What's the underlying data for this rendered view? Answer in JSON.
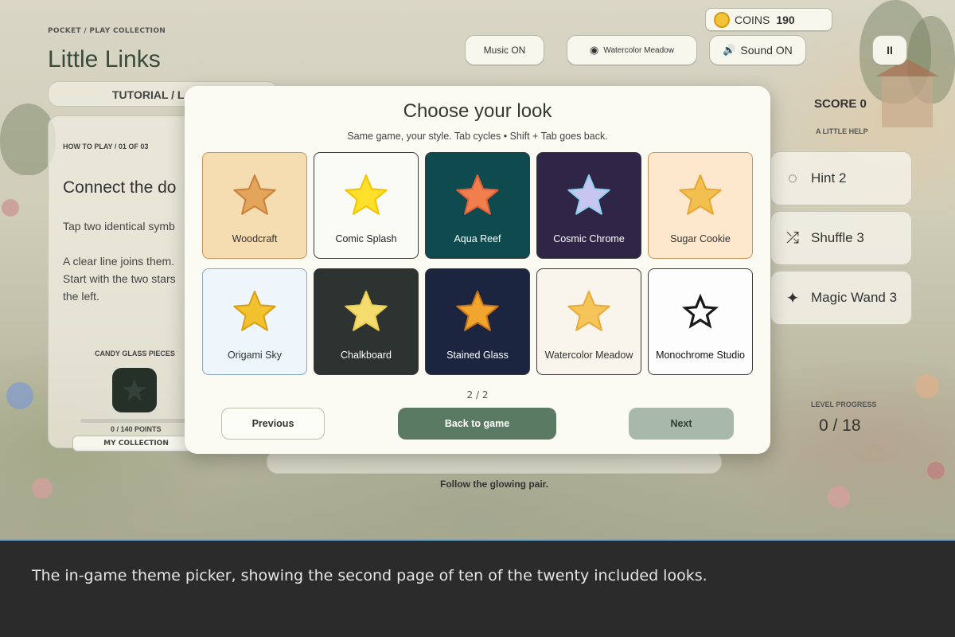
{
  "header": {
    "breadcrumb": "POCKET / PLAY COLLECTION",
    "title": "Little Links",
    "coins_label": "COINS",
    "coins_value": "190",
    "music": "Music  ON",
    "theme": "Watercolor Meadow",
    "sound": "Sound  ON",
    "pause": "II"
  },
  "left_panel": {
    "tab": "TUTORIAL  /  L",
    "how_to": "HOW TO PLAY  /  01 OF 03",
    "heading": "Connect the do",
    "line1": "Tap two identical symb",
    "line2": "A clear line joins them.",
    "line3": "Start with the two stars",
    "line4": "the left.",
    "pieces_label": "CANDY GLASS PIECES",
    "points": "0 / 140 POINTS",
    "collection": "MY COLLECTION"
  },
  "sidebar": {
    "score": "SCORE  0",
    "help_label": "A LITTLE HELP",
    "hint": "Hint  2",
    "shuffle": "Shuffle  3",
    "wand": "Magic Wand  3",
    "level_label": "LEVEL PROGRESS",
    "level_value": "0 / 18"
  },
  "bottom_hint": "Follow the glowing pair.",
  "modal": {
    "title": "Choose your look",
    "subtitle": "Same game, your style. Tab cycles • Shift + Tab goes back.",
    "page": "2 / 2",
    "prev": "Previous",
    "back": "Back to game",
    "next": "Next",
    "themes": [
      {
        "name": "Woodcraft",
        "bg": "#f5dcb1",
        "fg": "#333",
        "star": "#e2a55a",
        "star2": "#c9813d"
      },
      {
        "name": "Comic Splash",
        "bg": "#fbfbf6",
        "fg": "#222",
        "star": "#ffe02a",
        "star2": "#f2c300"
      },
      {
        "name": "Aqua Reef",
        "bg": "#0f4a4f",
        "fg": "#ffffff",
        "star": "#f07f4d",
        "star2": "#e0603a"
      },
      {
        "name": "Cosmic Chrome",
        "bg": "#2e2547",
        "fg": "#ffffff",
        "star": "#c8c6f0",
        "star2": "#8fd0ef"
      },
      {
        "name": "Sugar Cookie",
        "bg": "#fde7cd",
        "fg": "#333",
        "star": "#f2c04e",
        "star2": "#e5a636"
      },
      {
        "name": "Origami Sky",
        "bg": "#eef5fb",
        "fg": "#333",
        "star": "#f2c22e",
        "star2": "#d99e12"
      },
      {
        "name": "Chalkboard",
        "bg": "#2c3330",
        "fg": "#ffffff",
        "star": "#f5dc6f",
        "star2": "#eccd50"
      },
      {
        "name": "Stained Glass",
        "bg": "#1b2540",
        "fg": "#ffffff",
        "star": "#f0a52d",
        "star2": "#c8721a"
      },
      {
        "name": "Watercolor Meadow",
        "bg": "#faf5ec",
        "fg": "#333",
        "star": "#f5c55a",
        "star2": "#e9aa38"
      },
      {
        "name": "Monochrome Studio",
        "bg": "#fdfdfd",
        "fg": "#111",
        "star": "#1a1a1a",
        "star2": "#ffffff"
      }
    ]
  },
  "caption": "The in-game theme picker, showing the second page of ten of the twenty included looks."
}
